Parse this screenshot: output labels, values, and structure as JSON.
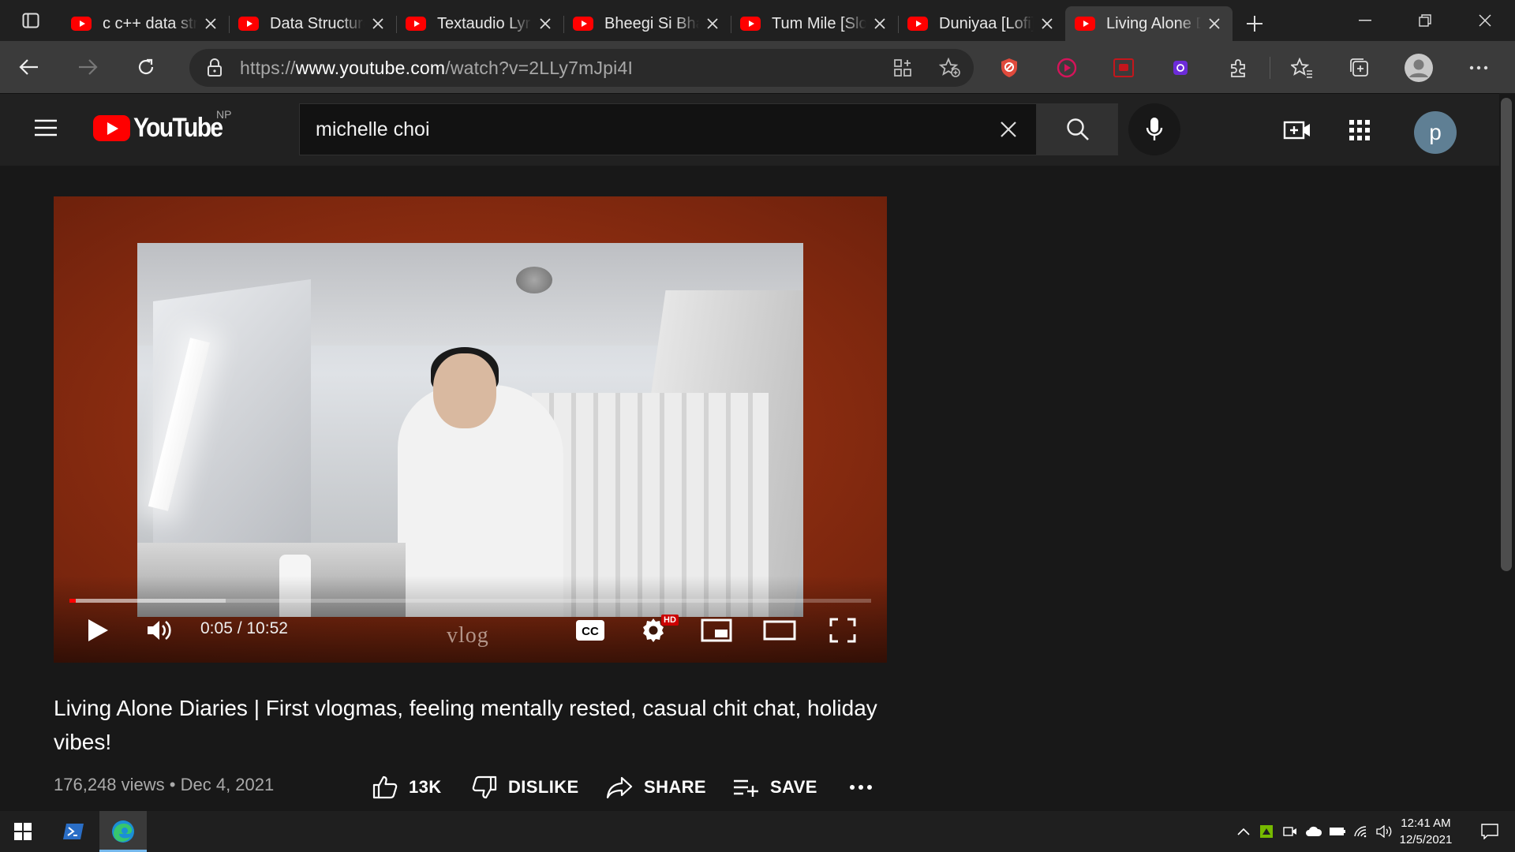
{
  "browser": {
    "tabs": [
      {
        "title": "c c++ data structures",
        "active": false
      },
      {
        "title": "Data Structures",
        "active": false
      },
      {
        "title": "Textaudio Lyrics",
        "active": false
      },
      {
        "title": "Bheegi Si Bhaagi Si",
        "active": false
      },
      {
        "title": "Tum Mile [Slowed]",
        "active": false
      },
      {
        "title": "Duniyaa [Lofi]",
        "active": false
      },
      {
        "title": "Living Alone Diaries",
        "active": true
      }
    ],
    "url_prefix": "https://",
    "url_domain": "www.youtube.com",
    "url_path": "/watch?v=2LLy7mJpi4I"
  },
  "youtube": {
    "logo_text": "YouTube",
    "country_code": "NP",
    "search_query": "michelle choi",
    "avatar_letter": "p"
  },
  "player": {
    "time_display": "0:05 / 10:52",
    "watermark": "vlog",
    "hd_badge": "HD",
    "played_fraction": 0.008,
    "loaded_fraction": 0.195
  },
  "video": {
    "title": "Living Alone Diaries | First vlogmas, feeling mentally rested, casual chit chat, holiday vibes!",
    "views": "176,248 views",
    "separator": "•",
    "date": "Dec 4, 2021",
    "likes": "13K",
    "dislike_label": "DISLIKE",
    "share_label": "SHARE",
    "save_label": "SAVE"
  },
  "taskbar": {
    "time": "12:41 AM",
    "date": "12/5/2021"
  },
  "colors": {
    "yt_red": "#ff0000",
    "player_bg": "#8a2c10",
    "avatar": "#5f7f94"
  }
}
